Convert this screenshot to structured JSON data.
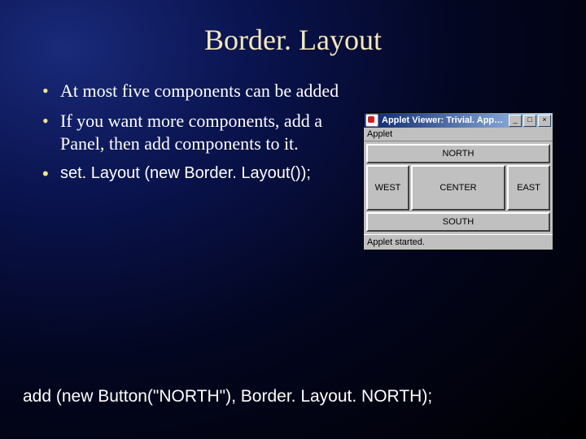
{
  "title": "Border. Layout",
  "bullets": {
    "b1": "At most five components can be added",
    "b2": "If you want more components, add a Panel, then add components to it.",
    "b3": "set. Layout (new Border. Layout());"
  },
  "applet": {
    "titlebar": "Applet Viewer: Trivial. App…",
    "btn_min": "_",
    "btn_max": "□",
    "btn_close": "×",
    "menu": "Applet",
    "north": "NORTH",
    "west": "WEST",
    "center": "CENTER",
    "east": "EAST",
    "south": "SOUTH",
    "status": "Applet started."
  },
  "bottom_code": "add (new Button(\"NORTH\"), Border. Layout. NORTH);"
}
